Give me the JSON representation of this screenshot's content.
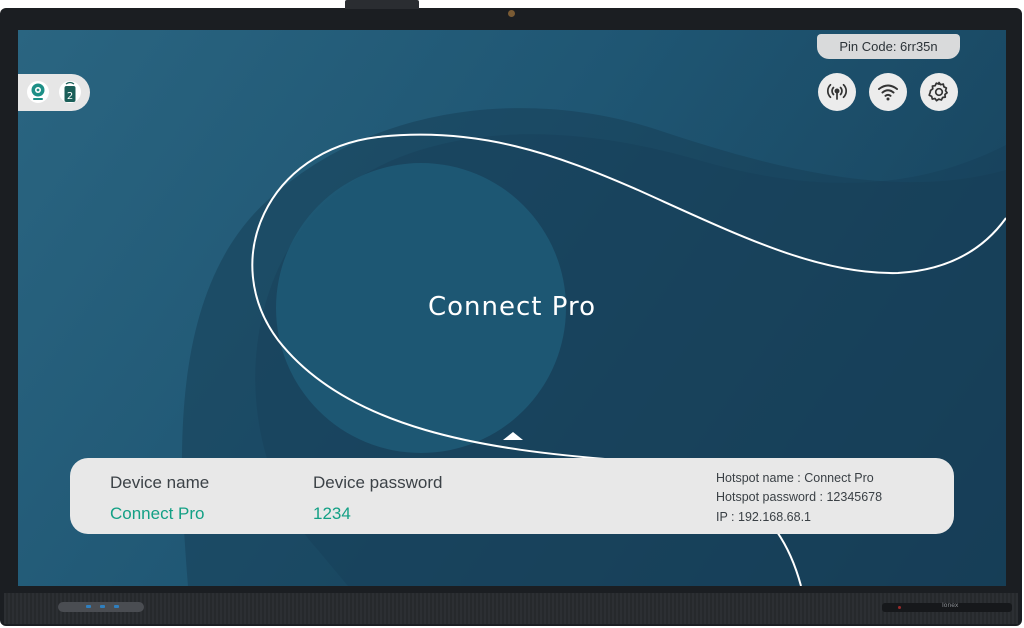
{
  "status": {
    "pin_code": "Pin Code: 6rr35n"
  },
  "left_icons": [
    {
      "icon": "webcam-icon"
    },
    {
      "icon": "wireless-dongle-icon",
      "badge": "2"
    }
  ],
  "top_right_buttons": [
    {
      "icon": "broadcast-icon"
    },
    {
      "icon": "wifi-icon"
    },
    {
      "icon": "gear-icon"
    }
  ],
  "main": {
    "app_title": "Connect Pro"
  },
  "info_card": {
    "device_name_label": "Device name",
    "device_name_value": "Connect Pro",
    "device_password_label": "Device password",
    "device_password_value": "1234",
    "hotspot_name": "Hotspot name :  Connect Pro",
    "hotspot_password": "Hotspot password : 12345678",
    "ip": "IP : 192.168.68.1"
  },
  "colors": {
    "accent_value": "#13a085",
    "screen_bg": "#1f5673",
    "pill_bg": "#e8e8e8"
  },
  "bezel": {
    "brand": "Ionex"
  }
}
